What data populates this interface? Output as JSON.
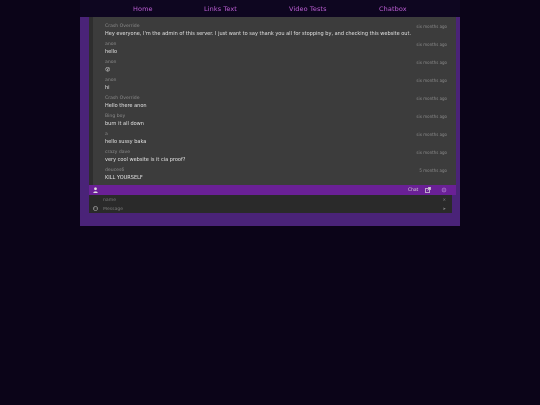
{
  "nav": {
    "links": [
      {
        "label": "Home"
      },
      {
        "label": "Links Text"
      },
      {
        "label": "Video Tests"
      },
      {
        "label": "Chatbox"
      }
    ]
  },
  "messages": [
    {
      "user": "Crash Override",
      "time": "six months ago",
      "text": "Hey everyone, I'm the admin of this server. I just want to say thank you all for stopping by, and checking this website out."
    },
    {
      "user": "anon",
      "time": "six months ago",
      "text": "hello"
    },
    {
      "user": "anon",
      "time": "six months ago",
      "text": "😮"
    },
    {
      "user": "anon",
      "time": "six months ago",
      "text": "hi"
    },
    {
      "user": "Crash Override",
      "time": "six months ago",
      "text": "Hello there anon"
    },
    {
      "user": "Bing boy",
      "time": "six months ago",
      "text": "burn it all down"
    },
    {
      "user": "a",
      "time": "six months ago",
      "text": "hello sussy baka"
    },
    {
      "user": "crazy dave",
      "time": "six months ago",
      "text": "very cool website is it cia proof?"
    },
    {
      "user": "deuces6",
      "time": "5 months ago",
      "text": "KILL YOURSELF"
    }
  ],
  "bar": {
    "user_icon": "user-icon",
    "chat_label": "Chat",
    "popout_icon": "external-link-icon",
    "settings_icon": "gear-icon"
  },
  "input": {
    "name_placeholder": "name",
    "message_placeholder": "Message",
    "send_icon": "send-icon"
  }
}
